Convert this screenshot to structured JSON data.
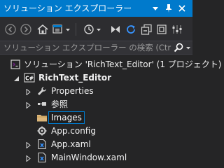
{
  "window": {
    "title": "ソリューション エクスプローラー",
    "buttons": [
      "dropdown-arrow-icon",
      "pin-icon",
      "close-icon"
    ]
  },
  "toolbar": {
    "items": [
      "back-icon",
      "forward-icon",
      "home-icon",
      "switch-views-icon",
      "pending-changes-icon",
      "sync-icon",
      "collapse-all-icon",
      "show-all-files-icon",
      "properties-icon"
    ]
  },
  "search": {
    "placeholder": "ソリューション エクスプローラー の検索 (Ctrl+:)"
  },
  "tree": {
    "solution": "ソリューション 'RichText_Editor' (1 プロジェクト)",
    "project": "RichText_Editor",
    "items": {
      "properties": "Properties",
      "references": "参照",
      "images": "Images",
      "app_config": "App.config",
      "app_xaml": "App.xaml",
      "main_window": "MainWindow.xaml"
    }
  },
  "colors": {
    "accent": "#007acc",
    "background": "#252526",
    "toolbar": "#2d2d30",
    "text": "#f1f1f1"
  }
}
